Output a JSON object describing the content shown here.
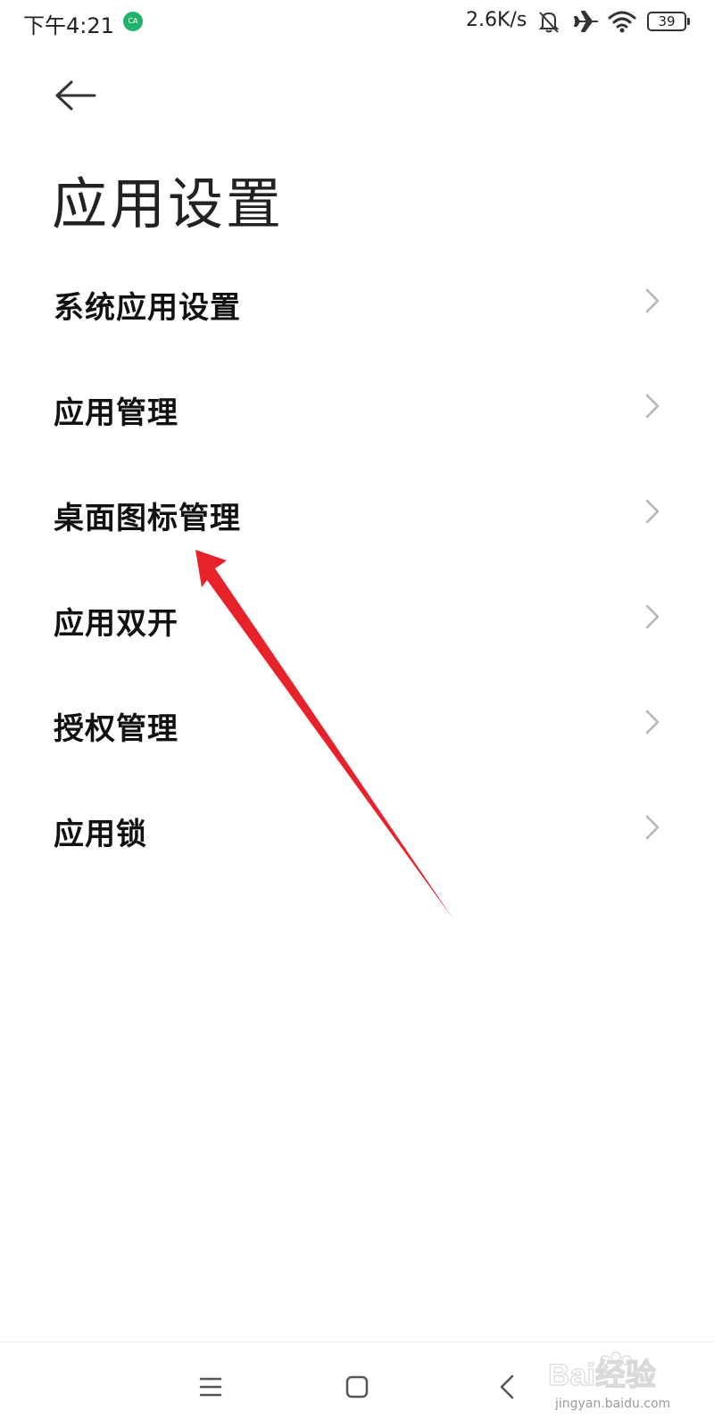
{
  "status_bar": {
    "time": "下午4:21",
    "app_icon_text": "CA",
    "net_speed": "2.6K/s",
    "battery_level": "39",
    "icons": [
      "bell-off-icon",
      "airplane-icon",
      "wifi-icon",
      "battery-icon"
    ]
  },
  "header": {
    "back_icon": "arrow-left-icon",
    "title": "应用设置"
  },
  "settings": {
    "items": [
      {
        "label": "系统应用设置"
      },
      {
        "label": "应用管理"
      },
      {
        "label": "桌面图标管理"
      },
      {
        "label": "应用双开"
      },
      {
        "label": "授权管理"
      },
      {
        "label": "应用锁"
      }
    ]
  },
  "annotation": {
    "color": "#e8222b",
    "target": "桌面图标管理"
  },
  "nav_bar": {
    "icons": [
      "menu-icon",
      "home-icon",
      "back-icon"
    ]
  },
  "watermark": {
    "brand": "Bai经验",
    "url": "jingyan.baidu.com"
  },
  "colors": {
    "background": "#ffffff",
    "text_primary": "#111111",
    "chevron": "#b5b5b5",
    "status_icon_green": "#21b36b"
  }
}
